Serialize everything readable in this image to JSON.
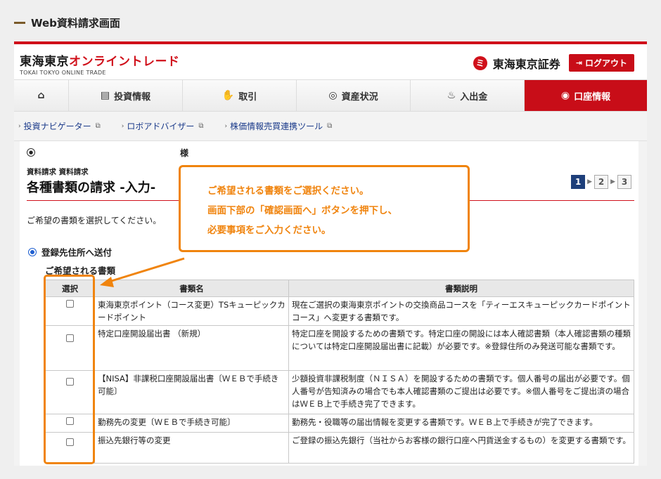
{
  "page_caption": "Web資料請求画面",
  "brand": {
    "logo_jp_black": "東海東京",
    "logo_jp_red": "オンライントレード",
    "logo_en": "TOKAI TOKYO ONLINE TRADE",
    "corp_name": "東海東京証券",
    "logout_label": "ログアウト"
  },
  "nav": {
    "items": [
      {
        "label": "投資情報"
      },
      {
        "label": "取引"
      },
      {
        "label": "資産状況"
      },
      {
        "label": "入出金"
      },
      {
        "label": "口座情報"
      }
    ]
  },
  "subnav": {
    "items": [
      {
        "label": "投資ナビゲーター"
      },
      {
        "label": "ロボアドバイザー"
      },
      {
        "label": "株価情報売買連携ツール"
      }
    ]
  },
  "user": {
    "suffix": "様"
  },
  "breadcrumb": "資料請求 資料請求",
  "title": "各種書類の請求 -入力-",
  "steps": [
    "1",
    "2",
    "3"
  ],
  "intro": "ご希望の書類を選択してください。",
  "delivery_option": "登録先住所へ送付",
  "section_label": "ご希望される書類",
  "table": {
    "headers": [
      "選択",
      "書類名",
      "書類説明"
    ],
    "rows": [
      {
        "name": "東海東京ポイント（コース変更）TSキューピックカードポイント",
        "desc": "現在ご選択の東海東京ポイントの交換商品コースを「ティーエスキューピックカードポイントコース」へ変更する書類です。"
      },
      {
        "name": "特定口座開設届出書 （新規）",
        "desc": "特定口座を開設するための書類です。特定口座の開設には本人確認書類（本人確認書類の種類については特定口座開設届出書に記載）が必要です。※登録住所のみ発送可能な書類です。"
      },
      {
        "name": "【NISA】非課税口座開設届出書〔ＷＥＢで手続き可能〕",
        "desc": "少額投資非課税制度（ＮＩＳＡ）を開設するための書類です。個人番号の届出が必要です。個人番号が告知済みの場合でも本人確認書類のご提出は必要です。※個人番号をご提出済の場合はＷＥＢ上で手続き完了できます。"
      },
      {
        "name": "勤務先の変更〔ＷＥＢで手続き可能〕",
        "desc": "勤務先・役職等の届出情報を変更する書類です。ＷＥＢ上で手続きが完了できます。"
      },
      {
        "name": "振込先銀行等の変更",
        "desc": "ご登録の振込先銀行（当社からお客様の銀行口座へ円貨送金するもの）を変更する書類です。"
      }
    ]
  },
  "callout": {
    "line1": "ご希望される書類をご選択ください。",
    "line2": "画面下部の「確認画面へ」ボタンを押下し、",
    "line3": "必要事項をご入力ください。"
  },
  "colors": {
    "brand_red": "#c80d18",
    "callout_orange": "#f0840e",
    "step_active": "#1e3f7a"
  }
}
